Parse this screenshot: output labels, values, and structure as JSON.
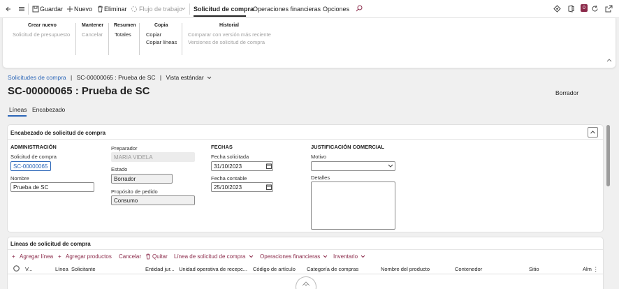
{
  "toolbar": {
    "save": "Guardar",
    "new": "Nuevo",
    "delete": "Eliminar",
    "workflow": "Flujo de trabajo",
    "tabs": [
      "Solicitud de compra",
      "Operaciones financieras",
      "Opciones"
    ],
    "notification_count": "0"
  },
  "ribbon": {
    "groups": [
      {
        "title": "Crear nuevo",
        "items": [
          "Solicitud de presupuesto"
        ]
      },
      {
        "title": "Mantener",
        "items": [
          "Cancelar"
        ]
      },
      {
        "title": "Resumen",
        "items": [
          "Totales"
        ]
      },
      {
        "title": "Copia",
        "items": [
          "Copiar",
          "Copiar líneas"
        ]
      },
      {
        "title": "Historial",
        "items": [
          "Comparar con versión más reciente",
          "Versiones de solicitud de compra"
        ]
      }
    ]
  },
  "breadcrumb": {
    "root": "Solicitudes de compra",
    "record": "SC-00000065 : Prueba de SC",
    "view": "Vista estándar"
  },
  "page": {
    "title": "SC-00000065 : Prueba de SC",
    "status": "Borrador",
    "tabs": [
      "Líneas",
      "Encabezado"
    ]
  },
  "header_card": {
    "title": "Encabezado de solicitud de compra",
    "admin": {
      "heading": "ADMINISTRACIÓN",
      "req_label": "Solicitud de compra",
      "req_value": "SC-00000065",
      "name_label": "Nombre",
      "name_value": "Prueba de SC"
    },
    "prep": {
      "preparer_label": "Preparador",
      "preparer_value": "MARIA VIDELA",
      "state_label": "Estado",
      "state_value": "Borrador",
      "purpose_label": "Propósito de pedido",
      "purpose_value": "Consumo"
    },
    "dates": {
      "heading": "FECHAS",
      "requested_label": "Fecha solicitada",
      "requested_value": "31/10/2023",
      "accounting_label": "Fecha contable",
      "accounting_value": "25/10/2023"
    },
    "justification": {
      "heading": "JUSTIFICACIÓN COMERCIAL",
      "reason_label": "Motivo",
      "reason_value": "",
      "details_label": "Detalles"
    }
  },
  "lines_card": {
    "title": "Líneas de solicitud de compra",
    "actions": [
      "Agregar línea",
      "Agregar productos",
      "Cancelar",
      "Quitar",
      "Línea de solicitud de compra",
      "Operaciones financieras",
      "Inventario"
    ],
    "columns": [
      "V...",
      "Línea",
      "Solicitante",
      "Entidad jur...",
      "Unidad operativa de recepc...",
      "Código de artículo",
      "Categoría de compras",
      "Nombre del producto",
      "Contenedor",
      "Sitio",
      "Alm"
    ]
  }
}
